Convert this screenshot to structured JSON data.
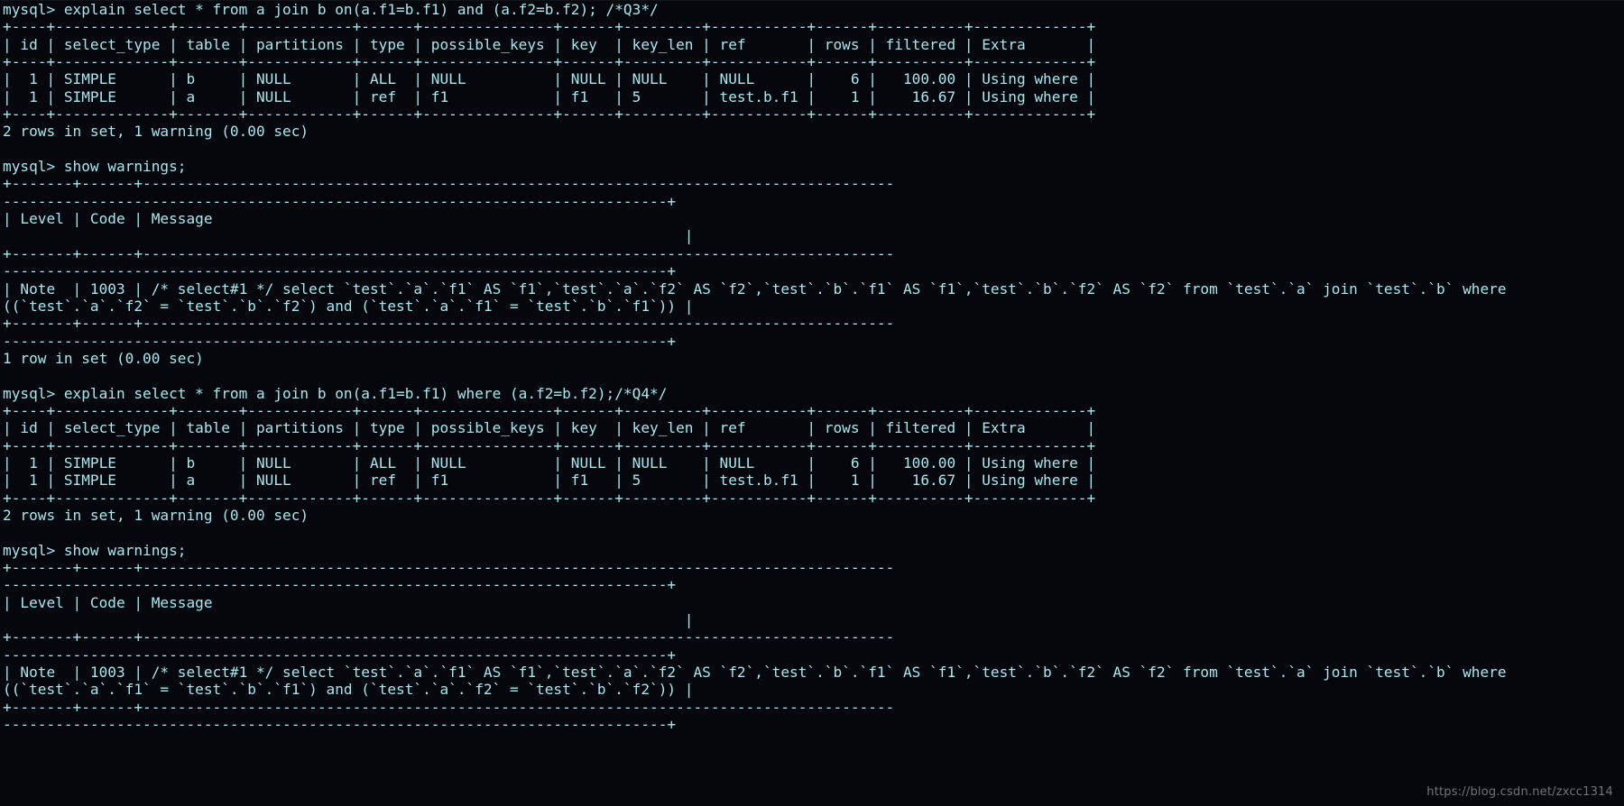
{
  "terminal": {
    "title": "mysql-client-terminal",
    "background_color": "#06070c",
    "text_color": "#a5e8ef",
    "watermark": "https://blog.csdn.net/zxcc1314",
    "prompt": "mysql>",
    "lines": [
      "mysql> explain select * from a join b on(a.f1=b.f1) and (a.f2=b.f2); /*Q3*/",
      "+----+-------------+-------+------------+------+---------------+------+---------+-----------+------+----------+-------------+",
      "| id | select_type | table | partitions | type | possible_keys | key  | key_len | ref       | rows | filtered | Extra       |",
      "+----+-------------+-------+------------+------+---------------+------+---------+-----------+------+----------+-------------+",
      "|  1 | SIMPLE      | b     | NULL       | ALL  | NULL          | NULL | NULL    | NULL      |    6 |   100.00 | Using where |",
      "|  1 | SIMPLE      | a     | NULL       | ref  | f1            | f1   | 5       | test.b.f1 |    1 |    16.67 | Using where |",
      "+----+-------------+-------+------------+------+---------------+------+---------+-----------+------+----------+-------------+",
      "2 rows in set, 1 warning (0.00 sec)",
      "",
      "mysql> show warnings;",
      "+-------+------+--------------------------------------------------------------------------------------",
      "----------------------------------------------------------------------------+",
      "| Level | Code | Message                                                                              ",
      "                                                                              |",
      "+-------+------+--------------------------------------------------------------------------------------",
      "----------------------------------------------------------------------------+",
      "| Note  | 1003 | /* select#1 */ select `test`.`a`.`f1` AS `f1`,`test`.`a`.`f2` AS `f2`,`test`.`b`.`f1` AS `f1`,`test`.`b`.`f2` AS `f2` from `test`.`a` join `test`.`b` where",
      "((`test`.`a`.`f2` = `test`.`b`.`f2`) and (`test`.`a`.`f1` = `test`.`b`.`f1`)) |",
      "+-------+------+--------------------------------------------------------------------------------------",
      "----------------------------------------------------------------------------+",
      "1 row in set (0.00 sec)",
      "",
      "mysql> explain select * from a join b on(a.f1=b.f1) where (a.f2=b.f2);/*Q4*/",
      "+----+-------------+-------+------------+------+---------------+------+---------+-----------+------+----------+-------------+",
      "| id | select_type | table | partitions | type | possible_keys | key  | key_len | ref       | rows | filtered | Extra       |",
      "+----+-------------+-------+------------+------+---------------+------+---------+-----------+------+----------+-------------+",
      "|  1 | SIMPLE      | b     | NULL       | ALL  | NULL          | NULL | NULL    | NULL      |    6 |   100.00 | Using where |",
      "|  1 | SIMPLE      | a     | NULL       | ref  | f1            | f1   | 5       | test.b.f1 |    1 |    16.67 | Using where |",
      "+----+-------------+-------+------------+------+---------------+------+---------+-----------+------+----------+-------------+",
      "2 rows in set, 1 warning (0.00 sec)",
      "",
      "mysql> show warnings;",
      "+-------+------+--------------------------------------------------------------------------------------",
      "----------------------------------------------------------------------------+",
      "| Level | Code | Message                                                                              ",
      "                                                                              |",
      "+-------+------+--------------------------------------------------------------------------------------",
      "----------------------------------------------------------------------------+",
      "| Note  | 1003 | /* select#1 */ select `test`.`a`.`f1` AS `f1`,`test`.`a`.`f2` AS `f2`,`test`.`b`.`f1` AS `f1`,`test`.`b`.`f2` AS `f2` from `test`.`a` join `test`.`b` where",
      "((`test`.`a`.`f1` = `test`.`b`.`f1`) and (`test`.`a`.`f2` = `test`.`b`.`f2`)) |",
      "+-------+------+--------------------------------------------------------------------------------------",
      "----------------------------------------------------------------------------+"
    ],
    "explain_table": {
      "columns": [
        "id",
        "select_type",
        "table",
        "partitions",
        "type",
        "possible_keys",
        "key",
        "key_len",
        "ref",
        "rows",
        "filtered",
        "Extra"
      ],
      "rows": [
        [
          "1",
          "SIMPLE",
          "b",
          "NULL",
          "ALL",
          "NULL",
          "NULL",
          "NULL",
          "NULL",
          "6",
          "100.00",
          "Using where"
        ],
        [
          "1",
          "SIMPLE",
          "a",
          "NULL",
          "ref",
          "f1",
          "f1",
          "5",
          "test.b.f1",
          "1",
          "16.67",
          "Using where"
        ]
      ]
    },
    "warnings_table": {
      "columns": [
        "Level",
        "Code",
        "Message"
      ]
    },
    "queries": [
      {
        "label": "Q3",
        "sql": "explain select * from a join b on(a.f1=b.f1) and (a.f2=b.f2); /*Q3*/",
        "result_status": "2 rows in set, 1 warning (0.00 sec)",
        "warning_status": "1 row in set (0.00 sec)",
        "warning_level": "Note",
        "warning_code": "1003",
        "warning_message": "/* select#1 */ select `test`.`a`.`f1` AS `f1`,`test`.`a`.`f2` AS `f2`,`test`.`b`.`f1` AS `f1`,`test`.`b`.`f2` AS `f2` from `test`.`a` join `test`.`b` where ((`test`.`a`.`f2` = `test`.`b`.`f2`) and (`test`.`a`.`f1` = `test`.`b`.`f1`))"
      },
      {
        "label": "Q4",
        "sql": "explain select * from a join b on(a.f1=b.f1) where (a.f2=b.f2);/*Q4*/",
        "result_status": "2 rows in set, 1 warning (0.00 sec)",
        "warning_level": "Note",
        "warning_code": "1003",
        "warning_message": "/* select#1 */ select `test`.`a`.`f1` AS `f1`,`test`.`a`.`f2` AS `f2`,`test`.`b`.`f1` AS `f1`,`test`.`b`.`f2` AS `f2` from `test`.`a` join `test`.`b` where ((`test`.`a`.`f1` = `test`.`b`.`f1`) and (`test`.`a`.`f2` = `test`.`b`.`f2`))"
      }
    ]
  }
}
